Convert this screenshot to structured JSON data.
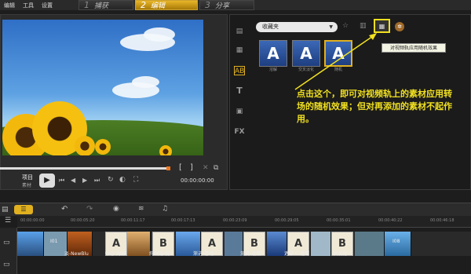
{
  "menu": [
    "编辑",
    "工具",
    "设置"
  ],
  "steps": [
    {
      "num": "1",
      "label": "捕获"
    },
    {
      "num": "2",
      "label": "编辑"
    },
    {
      "num": "3",
      "label": "分享"
    }
  ],
  "gallery": {
    "selected": "收藏夹"
  },
  "thumbs": [
    {
      "letter": "A",
      "label": "溶解"
    },
    {
      "letter": "A",
      "label": "交叉淡化"
    },
    {
      "letter": "A",
      "label": "随机"
    }
  ],
  "tooltip": "对视频轨应用随机效果",
  "annotation": "点击这个，即可对视频轨上的素材应用转场的随机效果；但对再添加的素材不起作用。",
  "controls": {
    "project": "项目",
    "clip": "素材",
    "timecode": "00:00:00:00"
  },
  "ruler": [
    "00:00:00:00",
    "00:00:05:20",
    "00:00:11:17",
    "00:00:17:13",
    "00:00:23:09",
    "00:00:29:05",
    "00:00:35:01",
    "00:00:40:22",
    "00:00:46:18"
  ],
  "clips": [
    {
      "label": "I01"
    },
    {
      "label": "淡-NewBlu"
    },
    {
      "label": "中心-对称"
    },
    {
      "label": "斜线链-旋"
    },
    {
      "label": "渐进-卷动"
    },
    {
      "label": "渐变-过渡"
    },
    {
      "label": "遮罩 C-遮罩"
    },
    {
      "label": "状淡化-!"
    },
    {
      "label": "I08"
    }
  ]
}
